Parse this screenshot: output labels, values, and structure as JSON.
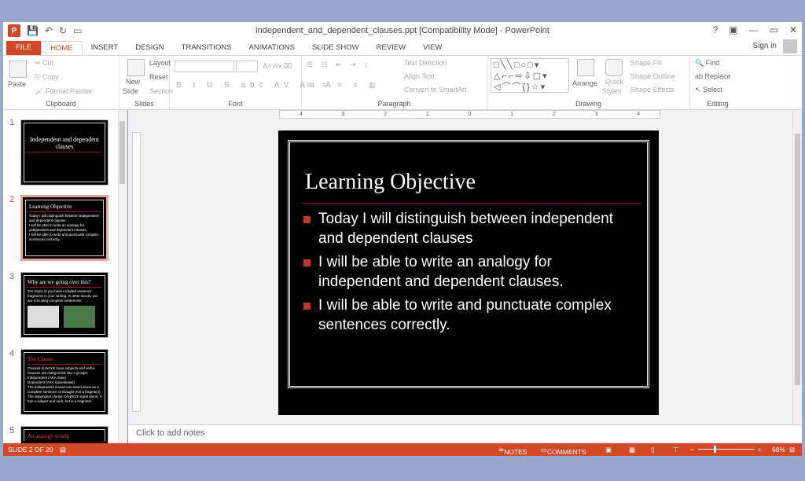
{
  "titlebar": {
    "title": "independent_and_dependent_clauses.ppt [Compatibility Mode] - PowerPoint",
    "help": "?",
    "min": "—",
    "max": "▭",
    "close": "✕"
  },
  "tabs": [
    "FILE",
    "HOME",
    "INSERT",
    "DESIGN",
    "TRANSITIONS",
    "ANIMATIONS",
    "SLIDE SHOW",
    "REVIEW",
    "VIEW"
  ],
  "signin": "Sign in",
  "ribbon": {
    "clipboard": {
      "label": "Clipboard",
      "paste": "Paste",
      "cut": "Cut",
      "copy": "Copy",
      "format_painter": "Format Painter"
    },
    "slides": {
      "label": "Slides",
      "new_slide": "New",
      "new_slide2": "Slide",
      "layout": "Layout",
      "reset": "Reset",
      "section": "Section"
    },
    "font": {
      "label": "Font"
    },
    "paragraph": {
      "label": "Paragraph",
      "text_direction": "Text Direction",
      "align_text": "Align Text",
      "smartart": "Convert to SmartArt"
    },
    "drawing": {
      "label": "Drawing",
      "arrange": "Arrange",
      "quick_styles": "Quick",
      "quick_styles2": "Styles",
      "shape_fill": "Shape Fill",
      "shape_outline": "Shape Outline",
      "shape_effects": "Shape Effects"
    },
    "editing": {
      "label": "Editing",
      "find": "Find",
      "replace": "Replace",
      "select": "Select"
    }
  },
  "thumbs": [
    {
      "num": "1",
      "title": "Independent and dependent clauses",
      "lines": []
    },
    {
      "num": "2",
      "title": "Learning Objective",
      "lines": [
        "Today I will distinguish between independent and dependent clauses",
        "I will be able to write an analogy for independent and dependent clauses.",
        "I will be able to write and punctuate complex sentences correctly."
      ]
    },
    {
      "num": "3",
      "title": "Why are we going over this?",
      "lines": [
        "Too many of you have included sentence fragments in your writing. In other words, you are not using complete sentences!"
      ]
    },
    {
      "num": "4",
      "title": "The Clause:",
      "lines": [
        "Clauses ALWAYS have subjects and verbs.",
        "Clauses are categorized into 2 groups: Independent (AKA main)",
        "Dependent (AKA subordinate)",
        "The independent clause can stand alone as a complete sentence or thought (not a fragment)",
        "The dependent clause CANNOT stand alone; it has a subject and verb, but is a fragment"
      ]
    },
    {
      "num": "5",
      "title": "An analogy to help",
      "lines": []
    }
  ],
  "slide": {
    "title": "Learning Objective",
    "bullets": [
      "Today I will distinguish between independent and dependent clauses",
      "I will be able to write an analogy for independent and dependent clauses.",
      "I will be able to write and punctuate complex sentences correctly."
    ]
  },
  "ruler": [
    "4",
    "3",
    "2",
    "1",
    "0",
    "1",
    "2",
    "3",
    "4"
  ],
  "notes_placeholder": "Click to add notes",
  "status": {
    "slide": "SLIDE 2 OF 20",
    "notes": "NOTES",
    "comments": "COMMENTS",
    "zoom": "68%"
  },
  "colors": {
    "accent": "#d24726",
    "bullet": "#c0392b",
    "slide_bg": "#000000"
  }
}
